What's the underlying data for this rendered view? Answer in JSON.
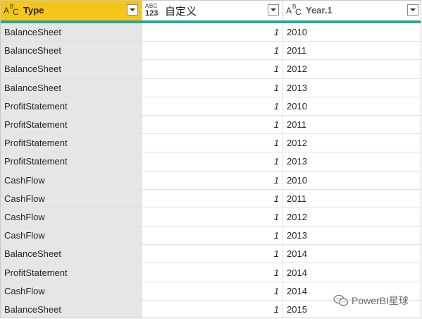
{
  "columns": [
    {
      "type_icon": "text-type-icon",
      "label": "Type"
    },
    {
      "type_icon": "any-type-icon",
      "label": "自定义"
    },
    {
      "type_icon": "text-type-icon",
      "label": "Year.1"
    }
  ],
  "type_icon_text": {
    "a": "A",
    "b": "B",
    "c": "C",
    "num_top": "ABC",
    "num_bot": "123"
  },
  "rows": [
    {
      "type": "BalanceSheet",
      "custom": "1",
      "year": "2010"
    },
    {
      "type": "BalanceSheet",
      "custom": "1",
      "year": "2011"
    },
    {
      "type": "BalanceSheet",
      "custom": "1",
      "year": "2012"
    },
    {
      "type": "BalanceSheet",
      "custom": "1",
      "year": "2013"
    },
    {
      "type": "ProfitStatement",
      "custom": "1",
      "year": "2010"
    },
    {
      "type": "ProfitStatement",
      "custom": "1",
      "year": "2011"
    },
    {
      "type": "ProfitStatement",
      "custom": "1",
      "year": "2012"
    },
    {
      "type": "ProfitStatement",
      "custom": "1",
      "year": "2013"
    },
    {
      "type": "CashFlow",
      "custom": "1",
      "year": "2010"
    },
    {
      "type": "CashFlow",
      "custom": "1",
      "year": "2011"
    },
    {
      "type": "CashFlow",
      "custom": "1",
      "year": "2012"
    },
    {
      "type": "CashFlow",
      "custom": "1",
      "year": "2013"
    },
    {
      "type": "BalanceSheet",
      "custom": "1",
      "year": "2014"
    },
    {
      "type": "ProfitStatement",
      "custom": "1",
      "year": "2014"
    },
    {
      "type": "CashFlow",
      "custom": "1",
      "year": "2014"
    },
    {
      "type": "BalanceSheet",
      "custom": "1",
      "year": "2015"
    }
  ],
  "watermark": {
    "text": "PowerBI星球",
    "icon": "wechat-icon"
  },
  "colors": {
    "selected_header": "#f5c518",
    "header_accent": "#21a89a",
    "first_column_bg": "#e6e6e6"
  }
}
